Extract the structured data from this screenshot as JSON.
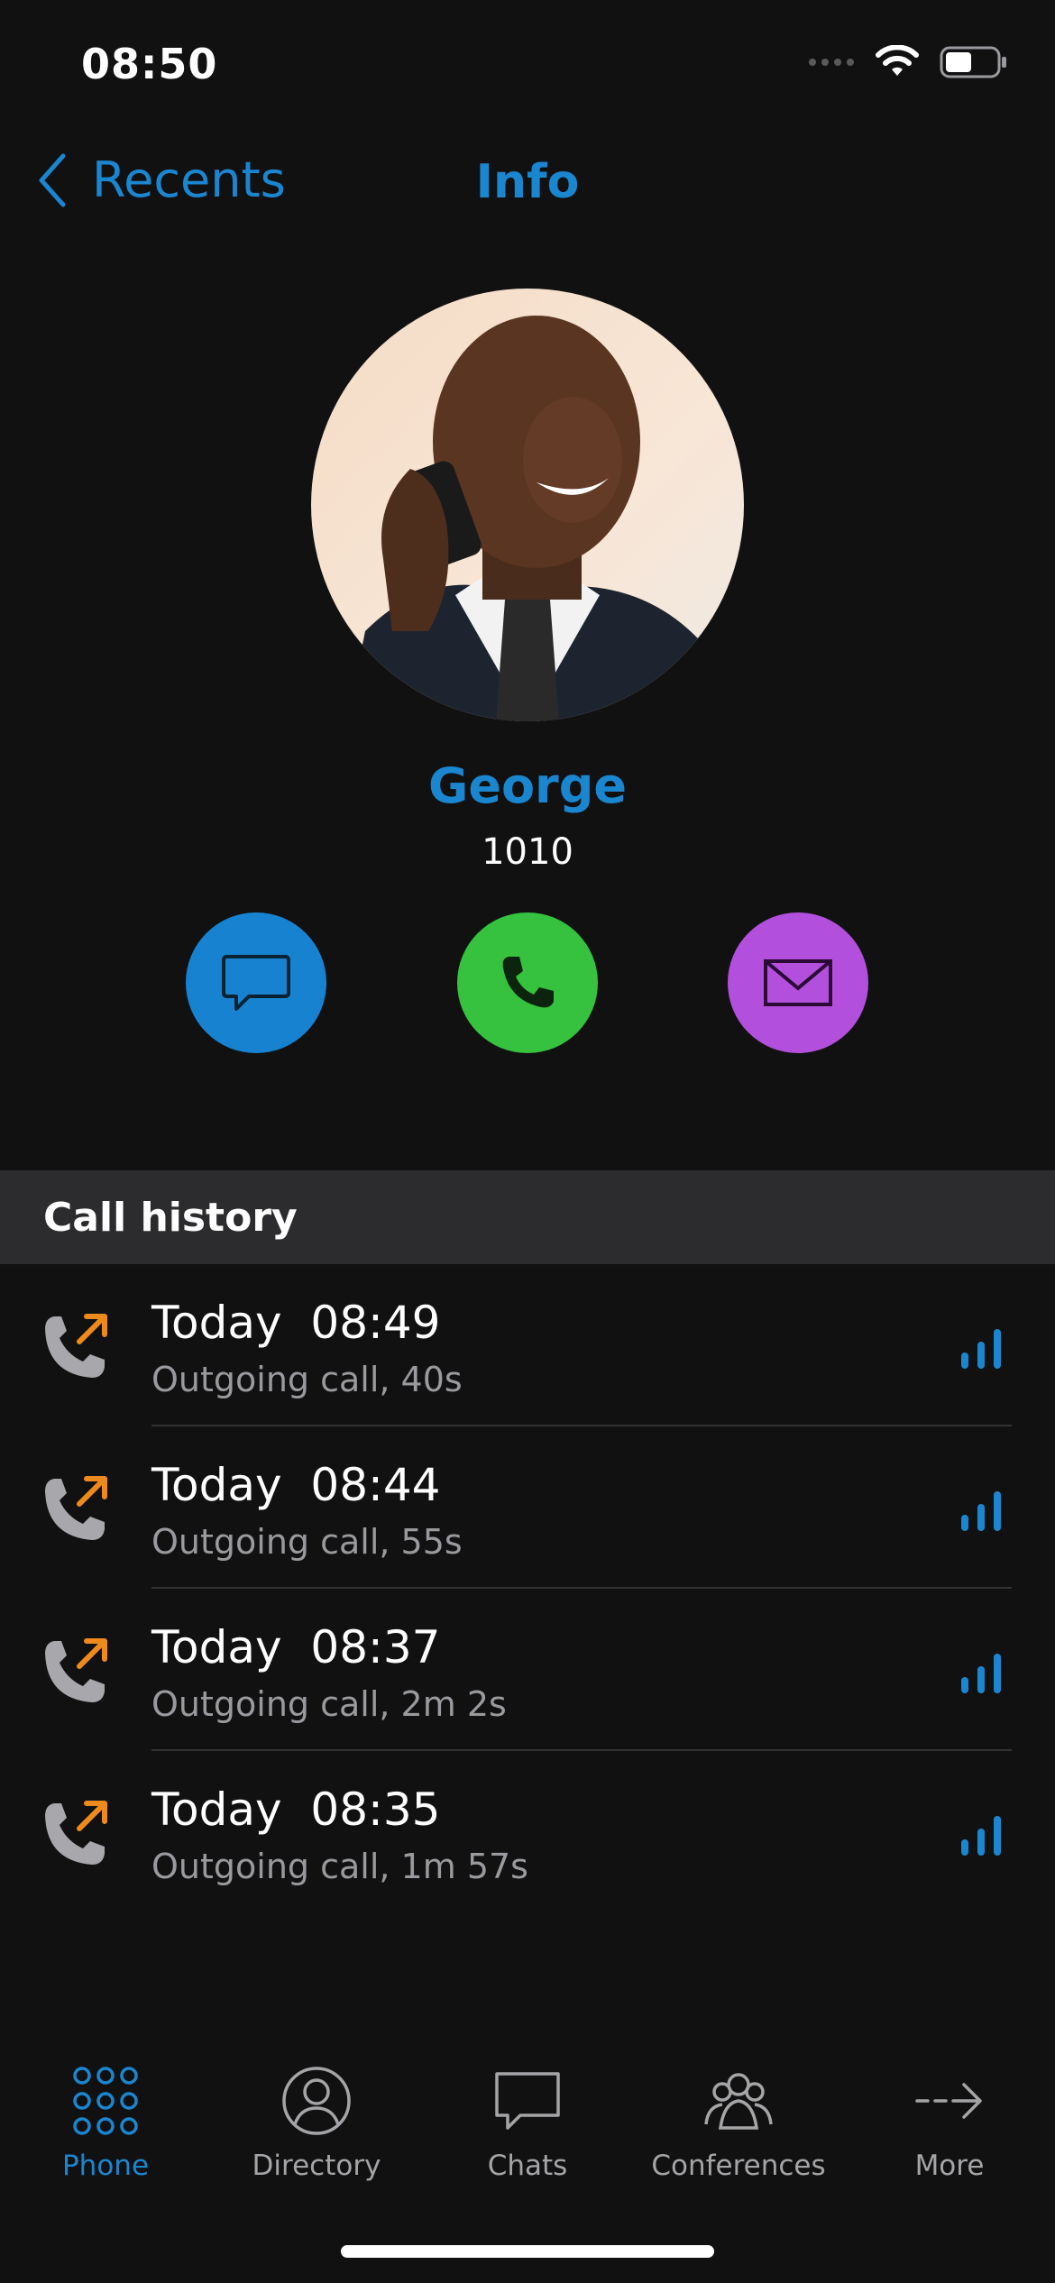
{
  "status_bar": {
    "time": "08:50",
    "icons": [
      "signal-dots-icon",
      "wifi-icon",
      "battery-icon"
    ]
  },
  "nav": {
    "back_label": "Recents",
    "title": "Info"
  },
  "contact": {
    "name": "George",
    "extension": "1010",
    "actions": [
      {
        "icon": "chat-icon",
        "color": "#1783d0"
      },
      {
        "icon": "phone-icon",
        "color": "#36c13e"
      },
      {
        "icon": "mail-icon",
        "color": "#b24fdc"
      }
    ]
  },
  "call_history": {
    "header": "Call history",
    "rows": [
      {
        "title": "Today  08:49",
        "subtitle": "Outgoing call, 40s"
      },
      {
        "title": "Today  08:44",
        "subtitle": "Outgoing call, 55s"
      },
      {
        "title": "Today  08:37",
        "subtitle": "Outgoing call, 2m 2s"
      },
      {
        "title": "Today  08:35",
        "subtitle": "Outgoing call, 1m 57s"
      }
    ]
  },
  "tabs": [
    {
      "label": "Phone",
      "icon": "keypad-icon",
      "active": true
    },
    {
      "label": "Directory",
      "icon": "person-icon",
      "active": false
    },
    {
      "label": "Chats",
      "icon": "chat-bubble-icon",
      "active": false
    },
    {
      "label": "Conferences",
      "icon": "group-icon",
      "active": false
    },
    {
      "label": "More",
      "icon": "arrow-right-icon",
      "active": false
    }
  ],
  "colors": {
    "accent": "#1b86d0",
    "outgoing_arrow": "#ee8a1c",
    "background": "#111112",
    "section_header": "#2c2c2e"
  }
}
